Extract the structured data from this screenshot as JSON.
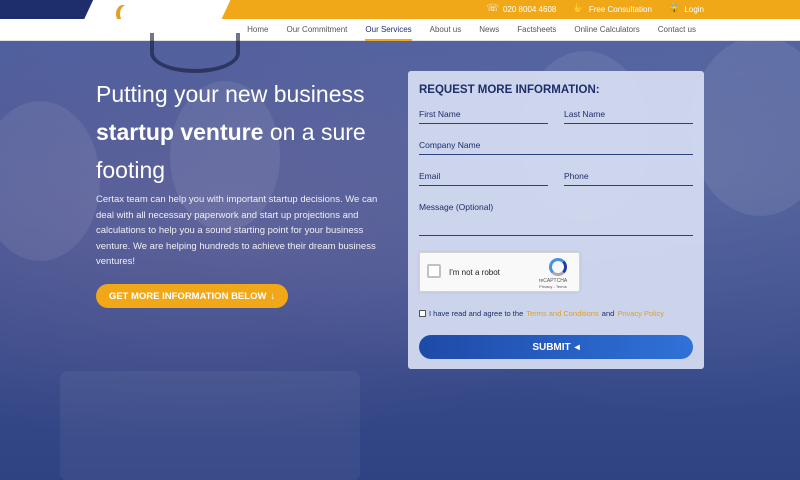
{
  "topbar": {
    "phone": "020 8004 4608",
    "consultation": "Free Consultation",
    "login": "Login",
    "phone_icon": "phone-icon",
    "handshake_icon": "handshake-icon",
    "lock_icon": "lock-icon"
  },
  "nav": {
    "items": [
      "Home",
      "Our Commitment",
      "Our Services",
      "About us",
      "News",
      "Factsheets",
      "Online Calculators",
      "Contact us"
    ],
    "active": "Our Services"
  },
  "hero": {
    "line1": "Putting your new business",
    "line2_bold": "startup venture",
    "line2_rest": " on a sure",
    "line3": "footing",
    "description": "Certax team can help you with important startup decisions. We can deal with all necessary paperwork and start up projections and calculations to help you a sound starting point for your business venture. We are helping hundreds to achieve their dream business ventures!",
    "cta": "GET MORE INFORMATION BELOW",
    "cta_icon": "↓"
  },
  "form": {
    "title": "REQUEST MORE INFORMATION:",
    "first_name": "First Name",
    "last_name": "Last Name",
    "company": "Company Name",
    "email": "Email",
    "phone": "Phone",
    "message": "Message (Optional)",
    "captcha_text": "I'm not a robot",
    "captcha_brand": "reCAPTCHA",
    "captcha_terms": "Privacy - Terms",
    "agree_prefix": "I have read and agree to the ",
    "terms_link": "Terms and Conditions",
    "agree_and": " and ",
    "privacy_link": "Privacy Policy",
    "submit": "SUBMIT",
    "submit_icon": "◂"
  },
  "colors": {
    "navy": "#1e2d6b",
    "gold": "#f0a818",
    "submit_blue": "#2f72d8"
  }
}
